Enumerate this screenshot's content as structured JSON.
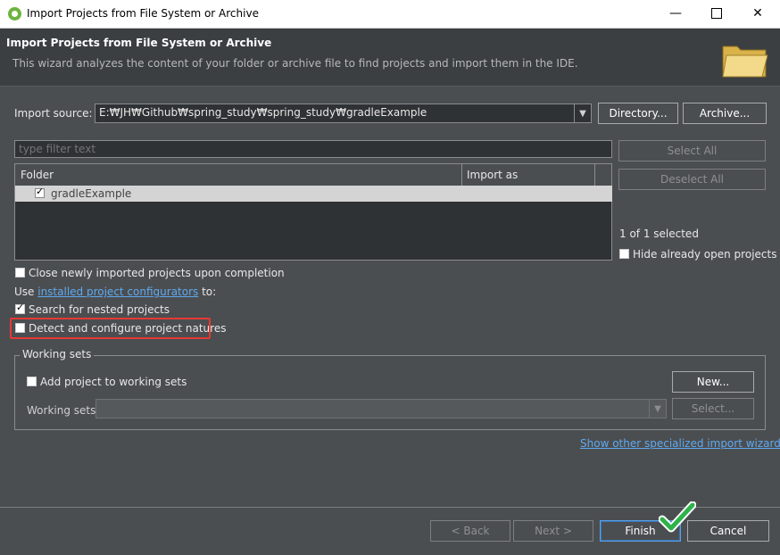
{
  "window": {
    "title": "Import Projects from File System or Archive",
    "minimize": "—",
    "close": "✕"
  },
  "banner": {
    "title": "Import Projects from File System or Archive",
    "description": "This wizard analyzes the content of your folder or archive file to find projects and import them in the IDE."
  },
  "import_source": {
    "label": "Import source:",
    "value": "E:₩JH₩Github₩spring_study₩spring_study₩gradleExample",
    "directory_button": "Directory...",
    "archive_button": "Archive..."
  },
  "filter": {
    "placeholder": "type filter text"
  },
  "table": {
    "headers": [
      "Folder",
      "Import as"
    ],
    "rows": [
      {
        "folder": "gradleExample",
        "import_as": "",
        "checked": true
      }
    ]
  },
  "side": {
    "select_all": "Select All",
    "deselect_all": "Deselect All",
    "selected_count": "1 of 1 selected",
    "hide_open": "Hide already open projects"
  },
  "options": {
    "close_newly": "Close newly imported projects upon completion",
    "use_prefix": "Use ",
    "configurators_link": "installed project configurators",
    "use_suffix": " to:",
    "search_nested": "Search for nested projects",
    "detect_configure": "Detect and configure project natures"
  },
  "working_sets": {
    "group_label": "Working sets",
    "add_project": "Add project to working sets",
    "new_button": "New...",
    "working_sets_label": "Working sets:",
    "select_button": "Select..."
  },
  "footer": {
    "show_other_link": "Show other specialized import wizards",
    "back": "< Back",
    "next": "Next >",
    "finish": "Finish",
    "cancel": "Cancel"
  },
  "colors": {
    "background": "#4b4e51",
    "banner": "#3b3f42",
    "link": "#5fa9ee",
    "highlight": "#e53935",
    "check_green": "#2db34a"
  }
}
